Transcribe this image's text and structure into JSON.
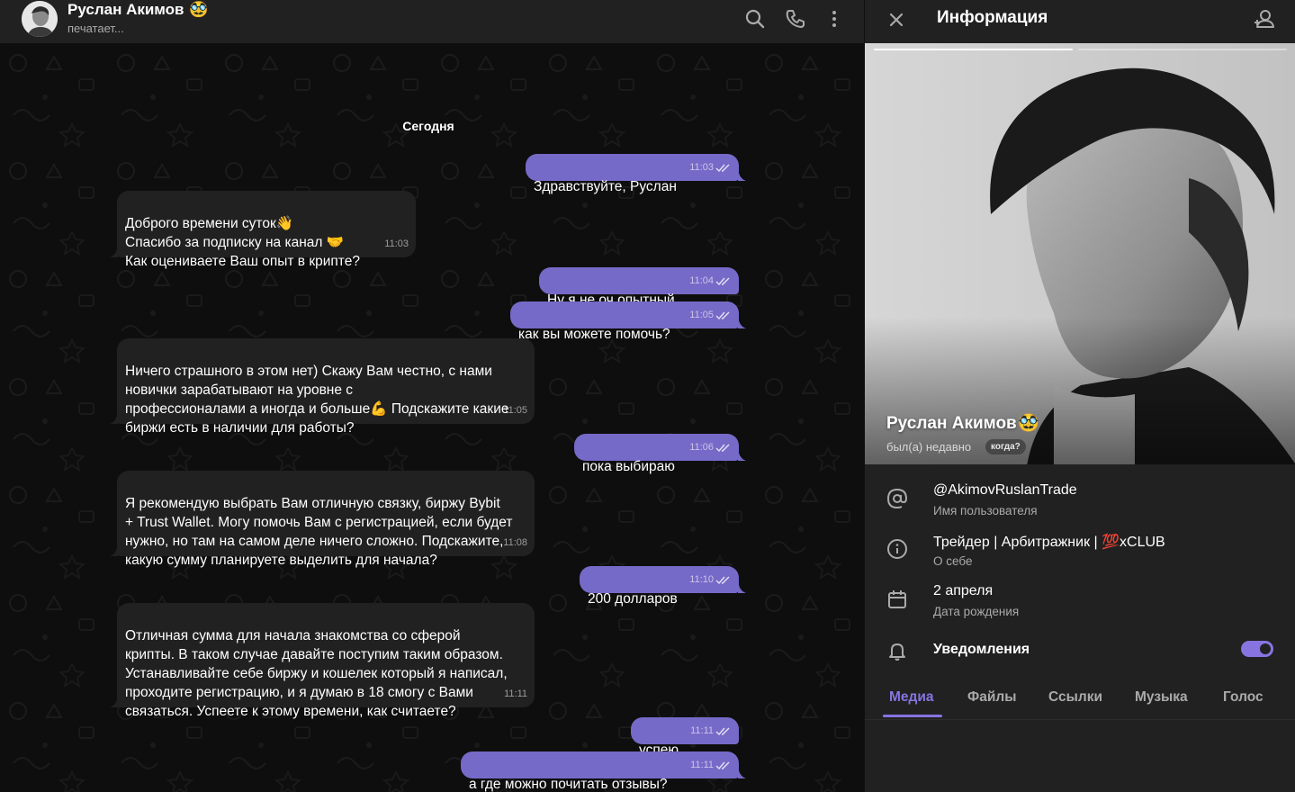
{
  "chat": {
    "peer_name": "Руслан Акимов",
    "peer_emoji": "🥸",
    "peer_status": "печатает...",
    "header_icons": [
      "search-icon",
      "phone-icon",
      "more-vertical-icon"
    ],
    "date_label": "Сегодня",
    "messages": [
      {
        "dir": "out",
        "text": "Здравствуйте, Руслан",
        "time": "11:03",
        "read": true
      },
      {
        "dir": "in",
        "text": "Доброго времени суток👋\nСпасибо за подписку на канал 🤝\nКак оцениваете Ваш опыт в крипте?",
        "time": "11:03"
      },
      {
        "dir": "out",
        "text": "Ну я не оч опытный",
        "time": "11:04",
        "read": true
      },
      {
        "dir": "out",
        "text": "как вы можете помочь?",
        "time": "11:05",
        "read": true
      },
      {
        "dir": "in",
        "text": "Ничего страшного в этом нет) Скажу Вам честно, с нами\nновички зарабатывают на уровне с\nпрофессионалами а иногда и больше💪 Подскажите какие\nбиржи есть в наличии для работы?",
        "time": "11:05"
      },
      {
        "dir": "out",
        "text": "пока выбираю",
        "time": "11:06",
        "read": true
      },
      {
        "dir": "in",
        "text": "Я рекомендую выбрать Вам отличную связку, биржу Bybit\n+ Trust Wallet. Могу помочь Вам с регистрацией, если будет\nнужно, но там на самом деле ничего сложно. Подскажите,\nкакую сумму планируете выделить для начала?",
        "time": "11:08"
      },
      {
        "dir": "out",
        "text": "200 долларов",
        "time": "11:10",
        "read": true
      },
      {
        "dir": "in",
        "text": "Отличная сумма для начала знакомства со сферой\nкрипты. В таком случае давайте поступим таким образом.\nУстанавливайте себе биржу и кошелек который я написал,\nпроходите регистрацию, и я думаю в 18 смогу с Вами\nсвязаться. Успеете к этому времени, как считаете?",
        "time": "11:11"
      },
      {
        "dir": "out",
        "text": "успею",
        "time": "11:11",
        "read": true
      },
      {
        "dir": "out",
        "text": "а где можно почитать отзывы?",
        "time": "11:11",
        "read": true
      }
    ]
  },
  "info": {
    "title": "Информация",
    "header_icons": [
      "close-icon",
      "add-contact-icon"
    ],
    "name": "Руслан Акимов",
    "emoji": "🥸",
    "status": "был(а) недавно",
    "when_chip": "когда?",
    "rows": [
      {
        "icon": "at-icon",
        "value": "@AkimovRuslanTrade",
        "label": "Имя пользователя"
      },
      {
        "icon": "info-icon",
        "value_prefix": "Трейдер | Арбитражник | ",
        "value_mark": "💯",
        "value_suffix": "xCLUB",
        "label": "О себе"
      },
      {
        "icon": "calendar-icon",
        "value": "2 апреля",
        "label": "Дата рождения"
      }
    ],
    "notifications_label": "Уведомления",
    "notifications_on": true,
    "tabs": [
      "Медиа",
      "Файлы",
      "Ссылки",
      "Музыка",
      "Голос"
    ],
    "active_tab": "Медиа"
  },
  "colors": {
    "accent": "#8774e1",
    "outgoing_bubble": "#766ac8",
    "incoming_bubble": "#212121",
    "panel": "#212121",
    "chat_bg": "#0e0e0e"
  }
}
